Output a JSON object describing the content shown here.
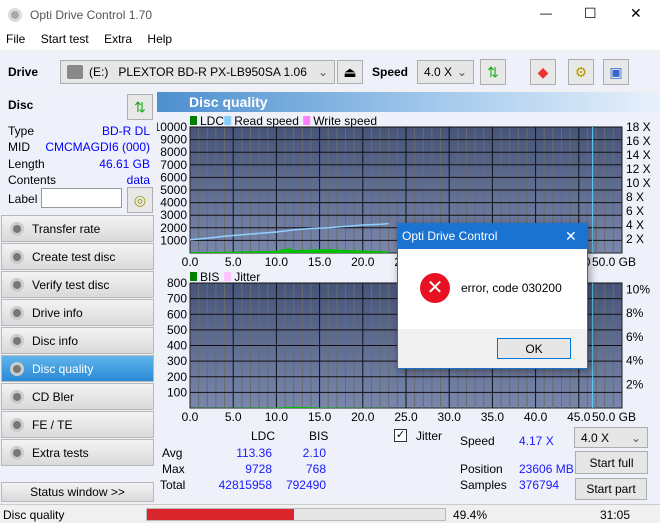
{
  "window": {
    "title": "Opti Drive Control 1.70",
    "minimize": "—",
    "maximize": "☐",
    "close": "✕"
  },
  "menu": [
    "File",
    "Start test",
    "Extra",
    "Help"
  ],
  "toolbar": {
    "drive_label": "Drive",
    "drive_letter": "(E:)",
    "drive_name": "PLEXTOR BD-R  PX-LB950SA 1.06",
    "speed_label": "Speed",
    "speed_value": "4.0 X"
  },
  "disc": {
    "title": "Disc",
    "type_label": "Type",
    "type": "BD-R DL",
    "mid_label": "MID",
    "mid": "CMCMAGDI6 (000)",
    "length_label": "Length",
    "length": "46.61 GB",
    "contents_label": "Contents",
    "contents": "data",
    "label_label": "Label",
    "label_value": ""
  },
  "sidebar": {
    "items": [
      {
        "label": "Transfer rate"
      },
      {
        "label": "Create test disc"
      },
      {
        "label": "Verify test disc"
      },
      {
        "label": "Drive info"
      },
      {
        "label": "Disc info"
      },
      {
        "label": "Disc quality",
        "selected": true
      },
      {
        "label": "CD Bler"
      },
      {
        "label": "FE / TE"
      },
      {
        "label": "Extra tests"
      }
    ],
    "status_window": "Status window >>"
  },
  "panel": {
    "title": "Disc quality"
  },
  "chart_data": [
    {
      "type": "line",
      "legend": [
        "LDC",
        "Read speed",
        "Write speed"
      ],
      "legend_colors": [
        "#008000",
        "#87cefa",
        "#ff80ff"
      ],
      "xlim": [
        0,
        50
      ],
      "xticks": [
        "0.0",
        "5.0",
        "10.0",
        "15.0",
        "20.0",
        "25.0",
        "30.0",
        "35.0",
        "40.0",
        "45.0",
        "50.0 GB"
      ],
      "ylim": [
        0,
        10000
      ],
      "yticks": [
        "1000",
        "2000",
        "3000",
        "4000",
        "5000",
        "6000",
        "7000",
        "8000",
        "9000",
        "10000"
      ],
      "y2lim": [
        0,
        18
      ],
      "y2ticks": [
        "2 X",
        "4 X",
        "6 X",
        "8 X",
        "10 X",
        "12 X",
        "14 X",
        "16 X",
        "18 X"
      ],
      "grid": true,
      "series": [
        {
          "name": "LDC",
          "x": [
            0,
            2,
            4,
            6,
            8,
            10,
            11.5,
            12,
            14,
            16,
            18,
            20,
            22,
            23
          ],
          "y": [
            60,
            80,
            100,
            120,
            150,
            180,
            400,
            220,
            280,
            300,
            240,
            200,
            150,
            100
          ]
        },
        {
          "name": "Read speed",
          "x": [
            0,
            2,
            4,
            6,
            8,
            10,
            12,
            14,
            16,
            18,
            20,
            22,
            23
          ],
          "y": [
            1.9,
            2.1,
            2.4,
            2.6,
            2.8,
            3.0,
            3.3,
            3.5,
            3.6,
            3.8,
            4.0,
            4.1,
            4.2
          ]
        }
      ],
      "marker_x": 46.6
    },
    {
      "type": "line",
      "legend": [
        "BIS",
        "Jitter"
      ],
      "legend_colors": [
        "#008000",
        "#ffc0ff"
      ],
      "xlim": [
        0,
        50
      ],
      "xticks": [
        "0.0",
        "5.0",
        "10.0",
        "15.0",
        "20.0",
        "25.0",
        "30.0",
        "35.0",
        "40.0",
        "45.0",
        "50.0 GB"
      ],
      "ylim": [
        0,
        800
      ],
      "yticks": [
        "100",
        "200",
        "300",
        "400",
        "500",
        "600",
        "700",
        "800"
      ],
      "y2ticks": [
        "2%",
        "4%",
        "6%",
        "8%",
        "10%"
      ],
      "grid": true,
      "series": [
        {
          "name": "BIS",
          "x": [
            0,
            5,
            10,
            12,
            15,
            20,
            23
          ],
          "y": [
            1,
            2,
            3,
            8,
            3,
            2,
            1
          ]
        }
      ],
      "marker_x": 46.6
    }
  ],
  "stats": {
    "col_ldc": "LDC",
    "col_bis": "BIS",
    "avg_label": "Avg",
    "avg_ldc": "113.36",
    "avg_bis": "2.10",
    "max_label": "Max",
    "max_ldc": "9728",
    "max_bis": "768",
    "total_label": "Total",
    "total_ldc": "42815958",
    "total_bis": "792490",
    "jitter_label": "Jitter",
    "jitter_checked": true,
    "speed_label": "Speed",
    "speed": "4.17 X",
    "position_label": "Position",
    "position": "23606 MB",
    "samples_label": "Samples",
    "samples": "376794",
    "speed_select": "4.0 X",
    "start_full": "Start full",
    "start_part": "Start part"
  },
  "statusbar": {
    "text": "Disc quality",
    "progress": 49.4,
    "progress_text": "49.4%",
    "time": "31:05",
    "progress_color": "#d9262c"
  },
  "dialog": {
    "title": "Opti Drive Control",
    "message": "error, code 030200",
    "ok": "OK",
    "close": "✕"
  }
}
